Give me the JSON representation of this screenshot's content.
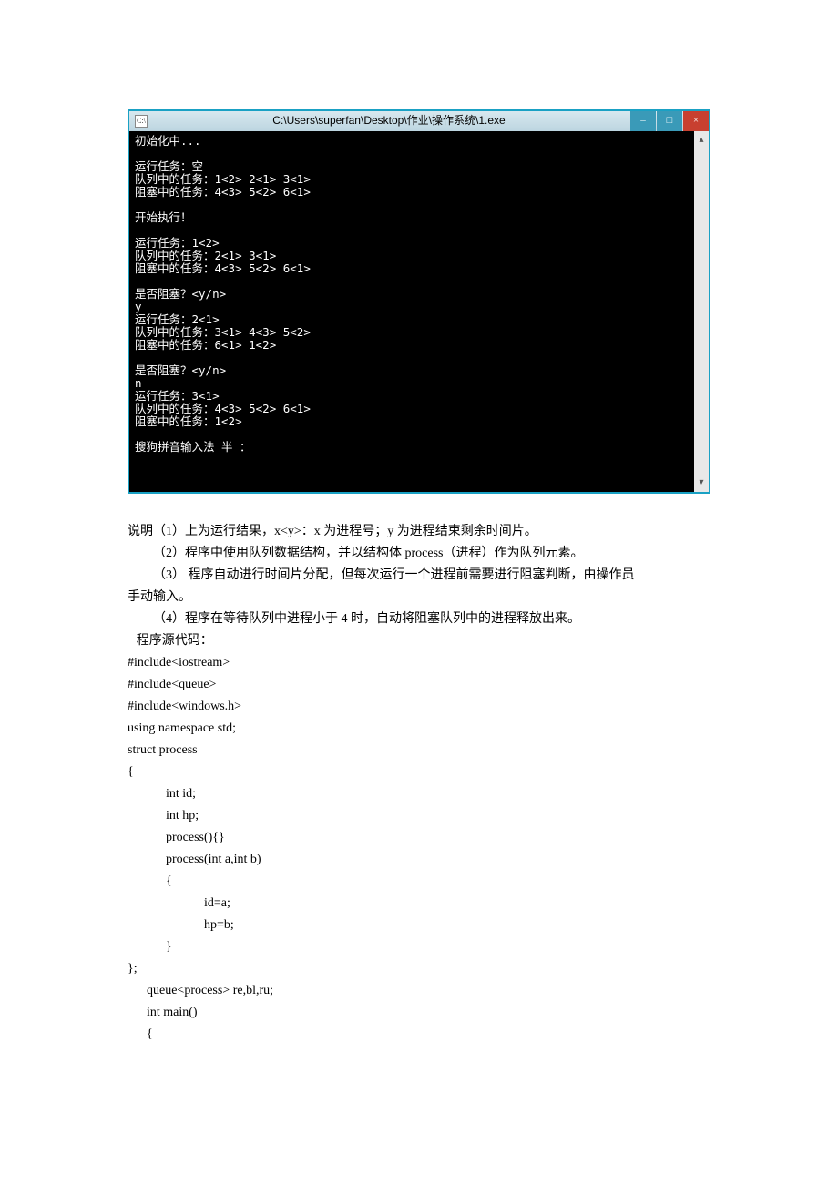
{
  "window": {
    "title": "C:\\Users\\superfan\\Desktop\\作业\\操作系统\\1.exe",
    "icon_label": "C:\\",
    "controls": {
      "min": "–",
      "max": "□",
      "close": "×"
    },
    "scroll": {
      "up": "▴",
      "down": "▾"
    }
  },
  "console_lines": [
    "初始化中...",
    "",
    "运行任务：空",
    "队列中的任务：1<2> 2<1> 3<1>",
    "阻塞中的任务：4<3> 5<2> 6<1>",
    "",
    "开始执行！",
    "",
    "运行任务：1<2>",
    "队列中的任务：2<1> 3<1>",
    "阻塞中的任务：4<3> 5<2> 6<1>",
    "",
    "是否阻塞？<y/n>",
    "y",
    "运行任务：2<1>",
    "队列中的任务：3<1> 4<3> 5<2>",
    "阻塞中的任务：6<1> 1<2>",
    "",
    "是否阻塞？<y/n>",
    "n",
    "运行任务：3<1>",
    "队列中的任务：4<3> 5<2> 6<1>",
    "阻塞中的任务：1<2>",
    "",
    "搜狗拼音输入法 半 ："
  ],
  "explanation": {
    "line1": "说明（1）上为运行结果，x<y>：x 为进程号；y 为进程结束剩余时间片。",
    "line2": "（2）程序中使用队列数据结构，并以结构体 process（进程）作为队列元素。",
    "line3a": "（3） 程序自动进行时间片分配，但每次运行一个进程前需要进行阻塞判断，由操作员",
    "line3b": "手动输入。",
    "line4": "（4）程序在等待队列中进程小于 4 时，自动将阻塞队列中的进程释放出来。",
    "src_label": " 程序源代码："
  },
  "code": {
    "l1": "#include<iostream>",
    "l2": "#include<queue>",
    "l3": "#include<windows.h>",
    "l4": "using namespace std;",
    "l5": "struct process",
    "l6": "{",
    "l7": "int id;",
    "l8": "int hp;",
    "l9": "process(){}",
    "l10": "process(int a,int b)",
    "l11": "{",
    "l12": "id=a;",
    "l13": "hp=b;",
    "l14": "}",
    "l15": "};",
    "blank": "",
    "l16": "queue<process> re,bl,ru;",
    "l17": "int main()",
    "l18": "{"
  }
}
